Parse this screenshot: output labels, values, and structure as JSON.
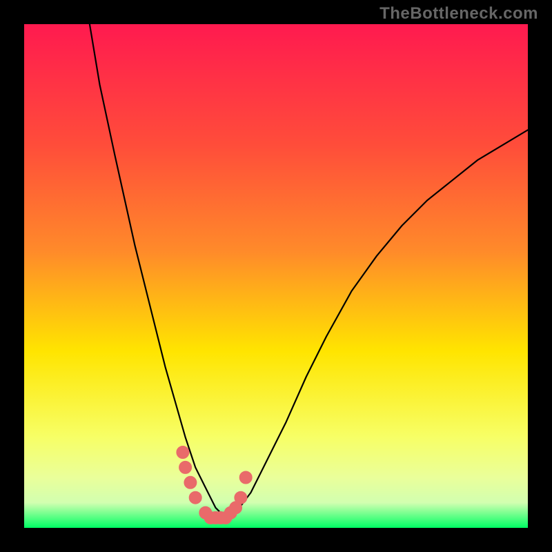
{
  "watermark": "TheBottleneck.com",
  "chart_data": {
    "type": "line",
    "title": "",
    "xlabel": "",
    "ylabel": "",
    "xlim": [
      0,
      100
    ],
    "ylim": [
      0,
      100
    ],
    "series": [
      {
        "name": "bottleneck-curve",
        "type": "line",
        "color": "#000000",
        "x": [
          13,
          15,
          18,
          20,
          22,
          24,
          26,
          28,
          30,
          32,
          34,
          36,
          38,
          40,
          42,
          45,
          48,
          52,
          56,
          60,
          65,
          70,
          75,
          80,
          85,
          90,
          95,
          100
        ],
        "values": [
          100,
          88,
          74,
          65,
          56,
          48,
          40,
          32,
          25,
          18,
          12,
          8,
          4,
          2,
          3,
          7,
          13,
          21,
          30,
          38,
          47,
          54,
          60,
          65,
          69,
          73,
          76,
          79
        ]
      },
      {
        "name": "highlight-markers",
        "type": "scatter",
        "color": "#e96a6a",
        "x": [
          31.5,
          32,
          33,
          34,
          36,
          37,
          38,
          39,
          40,
          41,
          42,
          43,
          44
        ],
        "values": [
          15,
          12,
          9,
          6,
          3,
          2,
          2,
          2,
          2,
          3,
          4,
          6,
          10
        ]
      }
    ],
    "background_gradient": {
      "top": "#ff1a4f",
      "upper_mid": "#ff8a2a",
      "mid": "#ffe500",
      "lower_mid": "#f7ff66",
      "bottom_band": "#d2ffb0",
      "bottom": "#00ff64"
    }
  }
}
